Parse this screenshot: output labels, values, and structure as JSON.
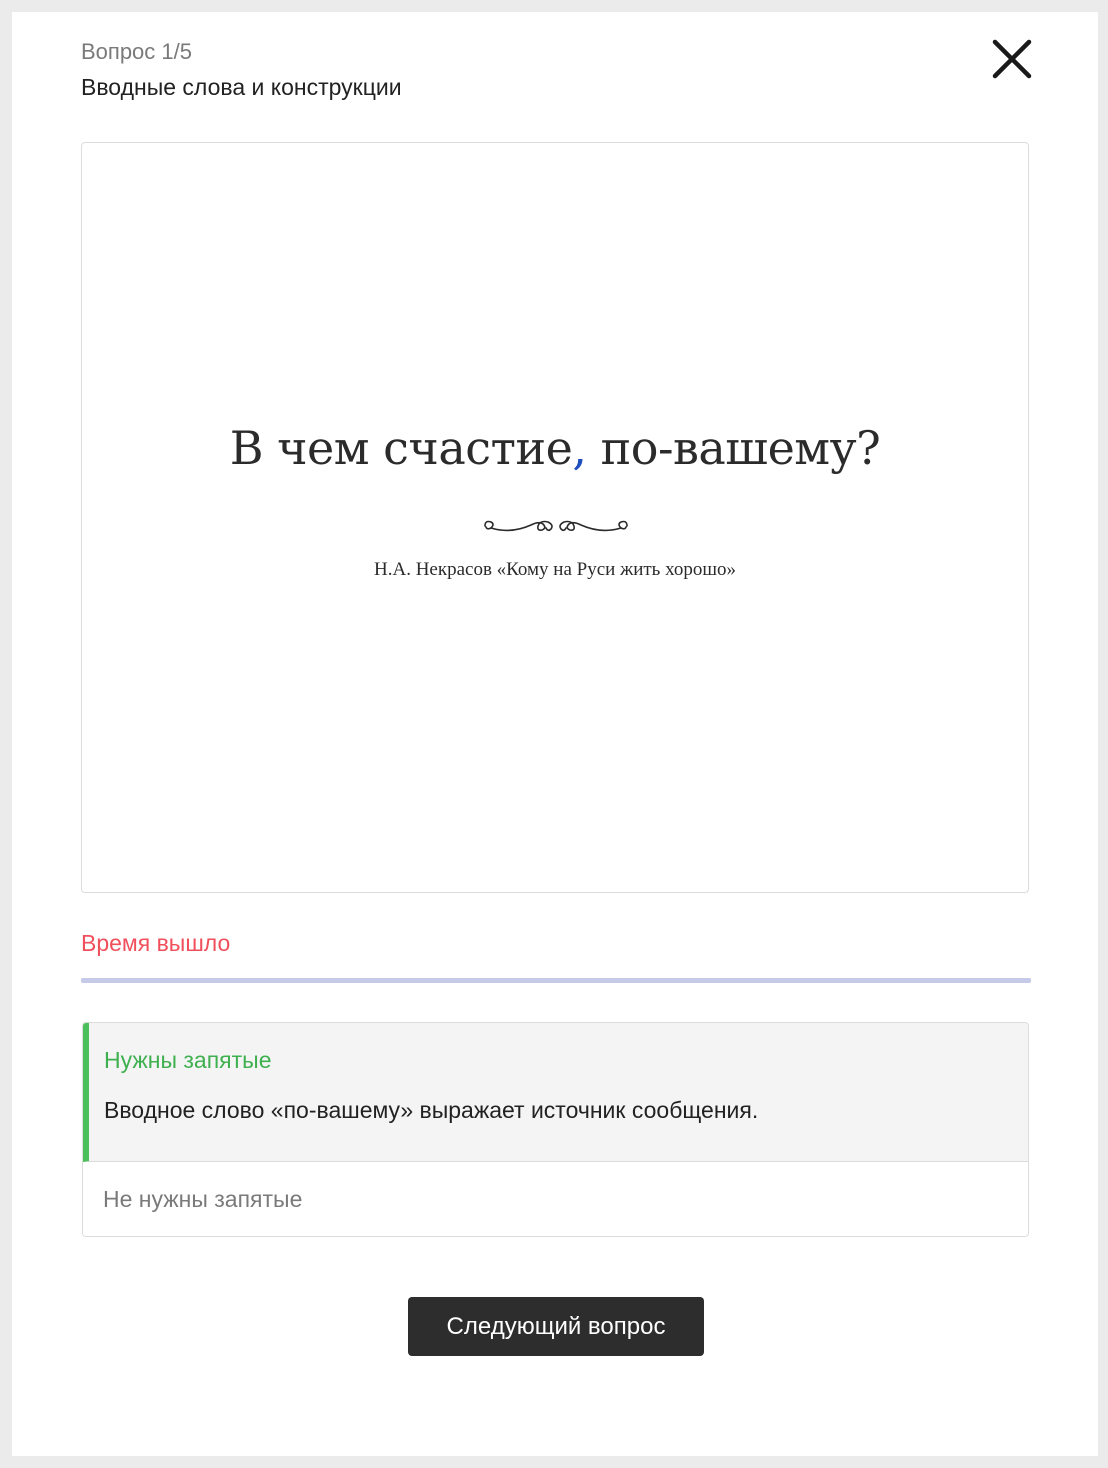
{
  "header": {
    "counter": "Вопрос 1/5",
    "topic": "Вводные слова и конструкции",
    "close_icon": "close-icon"
  },
  "quote": {
    "part_before": "В чем счастие",
    "comma": ",",
    "part_after": " по-вашему?",
    "attribution": "Н.А. Некрасов «Кому на Руси жить хорошо»",
    "comma_color": "#1f4fbf"
  },
  "timer": {
    "status": "Время вышло",
    "remaining_fraction": 0,
    "status_color": "#f0505c"
  },
  "answers": {
    "correct": {
      "label": "Нужны запятые",
      "explanation": "Вводное слово «по-вашему» выражает источник сообщения.",
      "accent_color": "#4bbf5a"
    },
    "other": {
      "label": "Не нужны запятые"
    }
  },
  "actions": {
    "next_label": "Следующий вопрос"
  }
}
